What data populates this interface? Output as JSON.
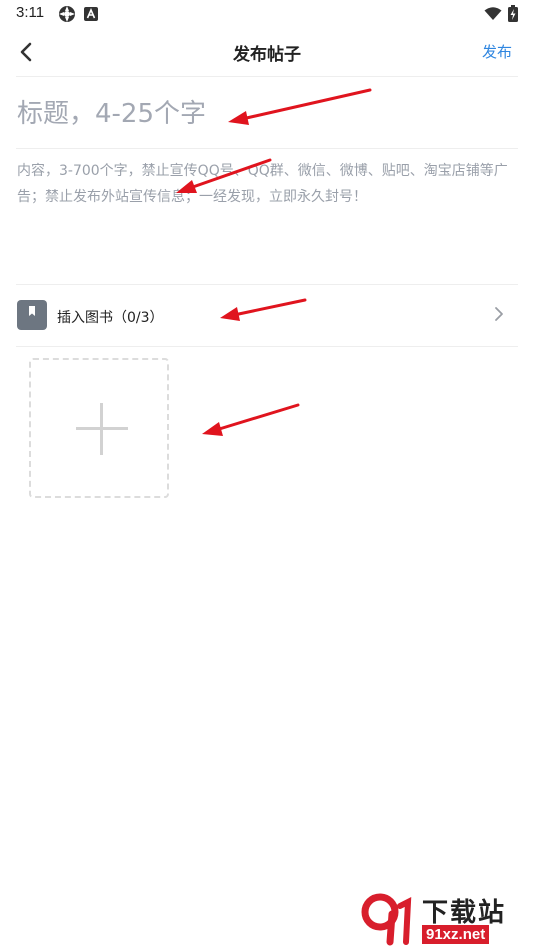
{
  "status_bar": {
    "time": "3:11",
    "icons": [
      "dots-icon",
      "a-badge-icon",
      "wifi-icon",
      "battery-charging-icon"
    ]
  },
  "nav": {
    "title": "发布帖子",
    "publish_label": "发布",
    "accent_color": "#2f86e0"
  },
  "form": {
    "title_placeholder": "标题，4-25个字",
    "content_placeholder": "内容，3-700个字，禁止宣传QQ号、QQ群、微信、微博、贴吧、淘宝店铺等广告；禁止发布外站宣传信息；一经发现，立即永久封号！"
  },
  "insert_book": {
    "label": "插入图书（0/3）",
    "icon": "bookmark-icon"
  },
  "add_image": {
    "icon": "plus-icon"
  },
  "watermark": {
    "title": "下载站",
    "domain": "91xz.net",
    "mark": "9f"
  },
  "annotation_color": "#e0141e"
}
